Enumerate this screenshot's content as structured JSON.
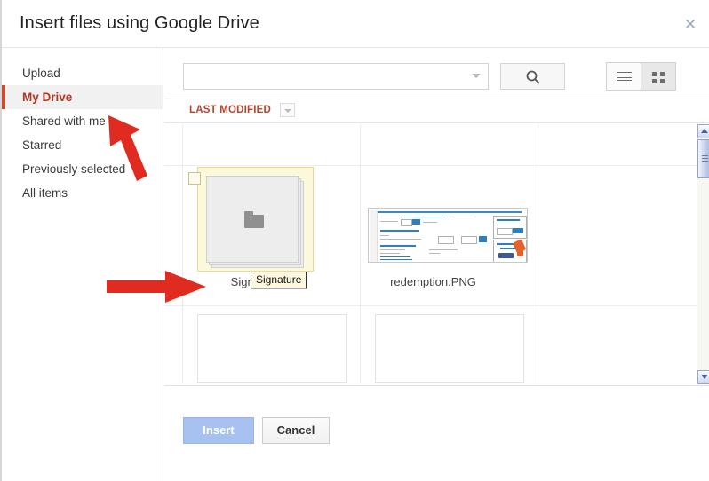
{
  "dialog": {
    "title": "Insert files using Google Drive",
    "close_icon": "close-icon",
    "close_glyph": "✕"
  },
  "sidebar": {
    "items": [
      {
        "label": "Upload",
        "active": false
      },
      {
        "label": "My Drive",
        "active": true
      },
      {
        "label": "Shared with me",
        "active": false
      },
      {
        "label": "Starred",
        "active": false
      },
      {
        "label": "Previously selected",
        "active": false
      },
      {
        "label": "All items",
        "active": false
      }
    ]
  },
  "toolbar": {
    "search": {
      "value": "",
      "placeholder": "",
      "caret_icon": "chevron-down-icon"
    },
    "search_button": {
      "icon": "search-icon",
      "label": ""
    },
    "view_toggle": {
      "list": {
        "icon": "list-view-icon",
        "active": false
      },
      "grid": {
        "icon": "grid-view-icon",
        "active": true
      }
    }
  },
  "sortbar": {
    "label": "LAST MODIFIED",
    "caret_icon": "chevron-down-icon"
  },
  "files": [
    {
      "name": "Signature",
      "type": "folder",
      "selected": true,
      "checked": false,
      "tooltip": "Signature"
    },
    {
      "name": "redemption.PNG",
      "type": "image",
      "selected": false,
      "checked": false,
      "tooltip": ""
    },
    {
      "name": "",
      "type": "placeholder",
      "selected": false,
      "checked": false,
      "tooltip": ""
    },
    {
      "name": "",
      "type": "placeholder",
      "selected": false,
      "checked": false,
      "tooltip": ""
    }
  ],
  "scrollbar": {
    "up_icon": "scroll-up-arrow-icon",
    "down_icon": "scroll-down-arrow-icon",
    "thumb_icon": "scrollbar-thumb"
  },
  "footer": {
    "insert_label": "Insert",
    "cancel_label": "Cancel"
  },
  "annotations": [
    {
      "name": "arrow-to-my-drive",
      "direction": "up-left",
      "color": "#e02b20"
    },
    {
      "name": "arrow-to-signature-file",
      "direction": "right",
      "color": "#e02b20"
    }
  ],
  "colors": {
    "accent_red": "#b5341f",
    "selection_yellow": "#fcf8dc",
    "primary_button": "#a7c1f0",
    "annotation_red": "#e02b20"
  }
}
